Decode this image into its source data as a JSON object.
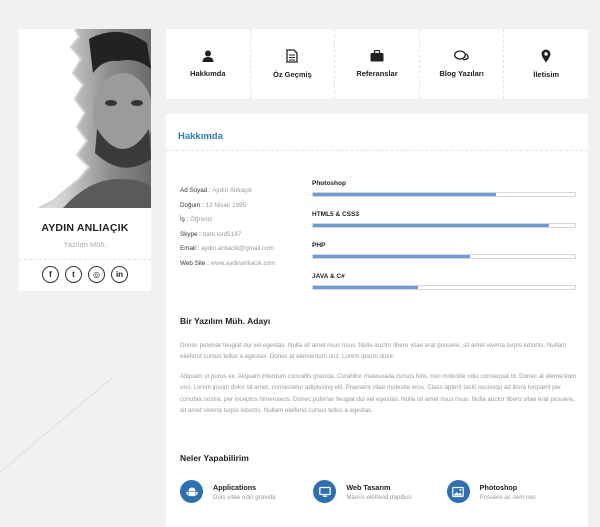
{
  "profile": {
    "name": "AYDIN ANLIAÇIK",
    "title": "Yazılım Müh.",
    "socials": [
      {
        "icon": "facebook-icon",
        "glyph": "f"
      },
      {
        "icon": "twitter-icon",
        "glyph": "t"
      },
      {
        "icon": "instagram-icon",
        "glyph": "◎"
      },
      {
        "icon": "linkedin-icon",
        "glyph": "in"
      }
    ]
  },
  "nav": {
    "items": [
      {
        "label": "Hakkımda",
        "icon": "user-icon"
      },
      {
        "label": "Öz Geçmiş",
        "icon": "document-icon"
      },
      {
        "label": "Referanslar",
        "icon": "briefcase-icon"
      },
      {
        "label": "Blog Yazıları",
        "icon": "comments-icon"
      },
      {
        "label": "İletisim",
        "icon": "location-pin-icon"
      }
    ]
  },
  "about": {
    "heading": "Hakkımda",
    "info": [
      {
        "key": "Ad Soyad :",
        "value": "Aydın Anlıaçık"
      },
      {
        "key": "Doğum :",
        "value": "12 Nisan 1995"
      },
      {
        "key": "İş :",
        "value": "Öğrenci"
      },
      {
        "key": "Skype :",
        "value": "dark.lord5187"
      },
      {
        "key": "Email :",
        "value": "aydin.anliacik@gmail.com"
      },
      {
        "key": "Web Site :",
        "value": "www.aydinanliacik.com"
      }
    ],
    "skills": [
      {
        "name": "Photoshop",
        "level": 0.7
      },
      {
        "name": "HTML5 & CSS3",
        "level": 0.9
      },
      {
        "name": "PHP",
        "level": 0.6
      },
      {
        "name": "JAVA & C#",
        "level": 0.4
      }
    ],
    "subtitle": "Bir Yazılım Müh. Adayı",
    "para1": "Donec pulvinar feugiat dui vel egestas. Nulla sit amet risus risus. Nulla auctor libero vitae erat posuere, sit amet viverra turpis lobortis. Nullam eleifend cursus tellus a egestas. Donec at elementum orci. Lorem ipsum dolor.",
    "para2": "Aliquam ut purus ex. Aliquam interdum convallis gravida. Curabitur malesuada cursus felis, non molestie odio consequat id. Donec at elementum orci. Lorem ipsum dolor sit amet, consectetur adipiscing elit. Praesent vitae molestie eros. Class aptent taciti sociosqu ad litora torquent per conubia nostra, per inceptos himenaeos. Donec pulvinar feugiat dui vel egestas. Nulla sit amet risus risus. Nulla auctor libero vitae erat posuere, sit amet viverra turpis lobortis. Nullam eleifend cursus tellus a egestas."
  },
  "services": {
    "heading": "Neler Yapabilirim",
    "items": [
      {
        "name": "Applications",
        "desc": "Duis vitae odio gravida",
        "icon": "android-icon"
      },
      {
        "name": "Web Tasarım",
        "desc": "Mauris eleifend dapibus",
        "icon": "monitor-icon"
      },
      {
        "name": "Photoshop",
        "desc": "Posuere ac sem nec",
        "icon": "image-icon"
      }
    ]
  },
  "colors": {
    "accent": "#2e7bbf",
    "bar": "#6c9bd6",
    "icon_bg": "#2e6fb0"
  }
}
